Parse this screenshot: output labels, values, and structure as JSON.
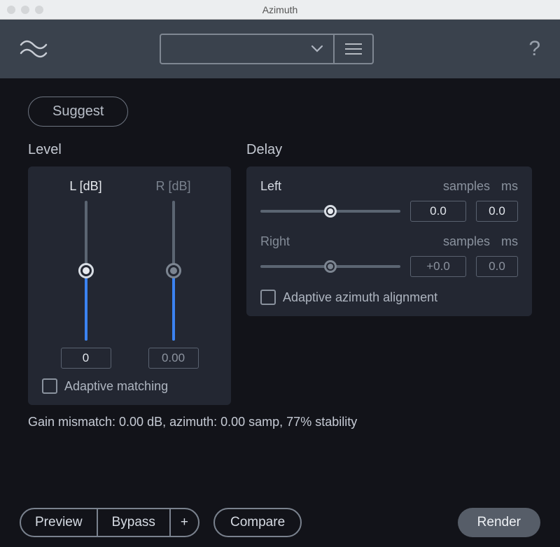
{
  "window": {
    "title": "Azimuth"
  },
  "toolbar": {
    "preset_value": "",
    "help_glyph": "?"
  },
  "suggest": {
    "label": "Suggest"
  },
  "level": {
    "title": "Level",
    "left_label": "L [dB]",
    "right_label": "R [dB]",
    "left_value": "0",
    "right_value": "0.00",
    "adaptive_label": "Adaptive matching",
    "adaptive_checked": false,
    "position_percent": 50
  },
  "delay": {
    "title": "Delay",
    "left": {
      "label": "Left",
      "samples_label": "samples",
      "ms_label": "ms",
      "samples_value": "0.0",
      "ms_value": "0.0",
      "active": true
    },
    "right": {
      "label": "Right",
      "samples_label": "samples",
      "ms_label": "ms",
      "samples_value": "+0.0",
      "ms_value": "0.0",
      "active": false
    },
    "adaptive_label": "Adaptive azimuth alignment",
    "adaptive_checked": false
  },
  "status": {
    "text": "Gain mismatch: 0.00 dB, azimuth: 0.00 samp, 77% stability"
  },
  "footer": {
    "preview": "Preview",
    "bypass": "Bypass",
    "plus": "+",
    "compare": "Compare",
    "render": "Render"
  },
  "colors": {
    "accent": "#3b82f0",
    "panel": "#232732",
    "bg": "#121319"
  }
}
